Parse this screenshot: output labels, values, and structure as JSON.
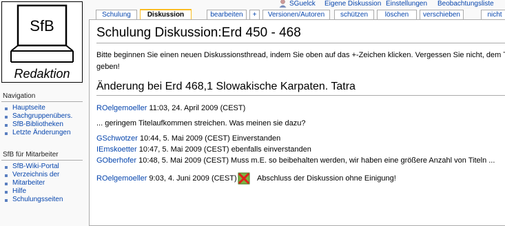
{
  "logo": {
    "top_text": "SfB",
    "bottom_text": "Redaktion"
  },
  "personal": {
    "username": "SGuelck",
    "discussion": "Eigene Diskussion",
    "settings": "Einstellungen",
    "watchlist": "Beobachtungsliste"
  },
  "tabs": {
    "schulung": "Schulung",
    "diskussion": "Diskussion",
    "edit": "bearbeiten",
    "add": "+",
    "history": "Versionen/Autoren",
    "protect": "schützen",
    "delete": "löschen",
    "move": "verschieben",
    "watch": "nicht"
  },
  "sidebar": {
    "navigation_title": "Navigation",
    "navigation": [
      "Hauptseite",
      "Sachgruppenübers.",
      "SfB-Bibliotheken",
      "Letzte Änderungen"
    ],
    "staff_title": "SfB für Mitarbeiter",
    "staff": [
      "SfB-Wiki-Portal",
      "Verzeichnis der",
      "Mitarbeiter",
      "Hilfe",
      "Schulungsseiten"
    ]
  },
  "content": {
    "title": "Schulung Diskussion:Erd 450 - 468",
    "intro_line1": "Bitte beginnen Sie einen neuen Diskussionsthread, indem Sie oben auf das +-Zeichen klicken. Vergessen Sie nicht, dem Th",
    "intro_line2": "geben!",
    "section_heading": "Änderung bei Erd 468,1 Slowakische Karpaten. Tatra",
    "posts": [
      {
        "user": "ROelgemoeller",
        "text": " 11:03, 24. April 2009 (CEST)"
      },
      {
        "user": "",
        "text": "... geringem Titelaufkommen streichen. Was meinen sie dazu?"
      },
      {
        "user": "GSchwotzer",
        "text": " 10:44, 5. Mai 2009 (CEST) Einverstanden"
      },
      {
        "user": "IEmskoetter",
        "text": " 10:47, 5. Mai 2009 (CEST) ebenfalls einverstanden"
      },
      {
        "user": "GOberhofer",
        "text": " 10:48, 5. Mai 2009 (CEST) Muss m.E. so beibehalten werden, wir haben eine größere Anzahl von Titeln ..."
      },
      {
        "user": "ROelgemoeller",
        "text": " 9:03, 4. Juni 2009 (CEST)"
      }
    ],
    "closing_text": "Abschluss der Diskussion ohne Einigung!"
  },
  "colors": {
    "link": "#0645ad",
    "active_tab_border": "#fabd23",
    "border": "#aaaaaa"
  }
}
